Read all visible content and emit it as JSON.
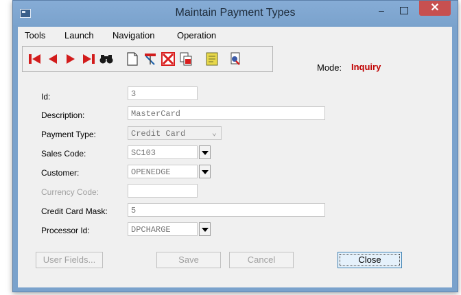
{
  "window": {
    "title": "Maintain Payment Types",
    "minimize": "–",
    "close": "✕"
  },
  "menu": [
    "Tools",
    "Launch",
    "Navigation",
    "Operation"
  ],
  "toolbar": {
    "buttons": [
      "first-record-icon",
      "previous-record-icon",
      "next-record-icon",
      "last-record-icon",
      "find-binoculars-icon",
      "new-document-icon",
      "edit-icon",
      "delete-icon",
      "copy-icon",
      "notes-icon",
      "print-preview-icon"
    ],
    "colors": {
      "nav_red": "#d21c1c",
      "delete_red": "#d91e1e",
      "note_yellow": "#e8d84a"
    }
  },
  "mode": {
    "label": "Mode:",
    "value": "Inquiry",
    "color": "#c00000"
  },
  "form": {
    "id": {
      "label": "Id:",
      "value": "3"
    },
    "description": {
      "label": "Description:",
      "value": "MasterCard"
    },
    "payment_type": {
      "label": "Payment Type:",
      "value": "Credit Card"
    },
    "sales_code": {
      "label": "Sales Code:",
      "value": "SC103"
    },
    "customer": {
      "label": "Customer:",
      "value": "OPENEDGE"
    },
    "currency_code": {
      "label": "Currency Code:",
      "value": ""
    },
    "credit_card_mask": {
      "label": "Credit Card Mask:",
      "value": "5"
    },
    "processor_id": {
      "label": "Processor Id:",
      "value": "DPCHARGE"
    }
  },
  "buttons": {
    "user_fields": "User Fields...",
    "save": "Save",
    "cancel": "Cancel",
    "close": "Close"
  }
}
